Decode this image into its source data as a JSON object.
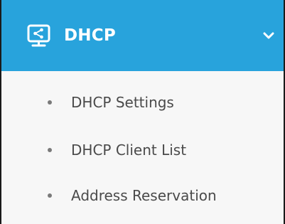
{
  "menu": {
    "section_title": "DHCP",
    "section_icon": "monitor-share-icon",
    "expand_icon": "chevron-down-icon",
    "items": [
      {
        "label": "DHCP Settings"
      },
      {
        "label": "DHCP Client List"
      },
      {
        "label": "Address Reservation"
      }
    ]
  },
  "colors": {
    "header_background": "#28a3dc",
    "header_text": "#ffffff",
    "item_text": "#4a4a4a",
    "panel_background": "#f7f7f7"
  }
}
